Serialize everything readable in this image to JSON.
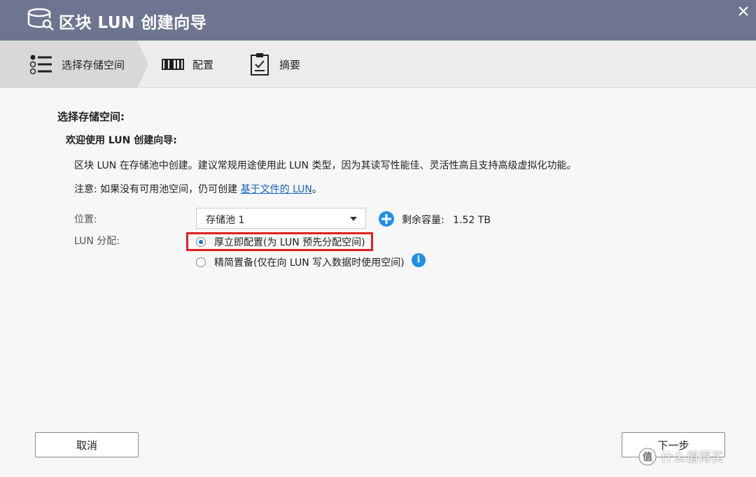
{
  "window": {
    "title": "区块 LUN 创建向导"
  },
  "steps": [
    {
      "label": "选择存储空间",
      "icon": "list-icon",
      "active": true
    },
    {
      "label": "配置",
      "icon": "barcode-icon"
    },
    {
      "label": "摘要",
      "icon": "clipboard-icon"
    }
  ],
  "main": {
    "heading": "选择存储空间:",
    "welcome": "欢迎使用 LUN 创建向导:",
    "description": "区块 LUN 在存储池中创建。建议常规用途使用此 LUN 类型，因为其读写性能佳、灵活性高且支持高级虚拟化功能。",
    "note_prefix": "注意: 如果没有可用池空间，仍可创建 ",
    "note_link": "基于文件的 LUN",
    "note_suffix": "。",
    "location_label": "位置:",
    "location_value": "存储池 1",
    "capacity_label": "剩余容量:",
    "capacity_value": "1.52 TB",
    "allocation_label": "LUN 分配:",
    "options": [
      {
        "label": "厚立即配置(为 LUN 预先分配空间)",
        "selected": true
      },
      {
        "label": "精简置备(仅在向 LUN 写入数据时使用空间)",
        "selected": false
      }
    ],
    "info_glyph": "i"
  },
  "footer": {
    "cancel_label": "取消",
    "next_label": "下一步"
  },
  "watermark": "什么值得买",
  "colors": {
    "titlebar": "#6d7590",
    "accent": "#1a73e8",
    "highlight": "#e02020",
    "link": "#1565c0"
  }
}
